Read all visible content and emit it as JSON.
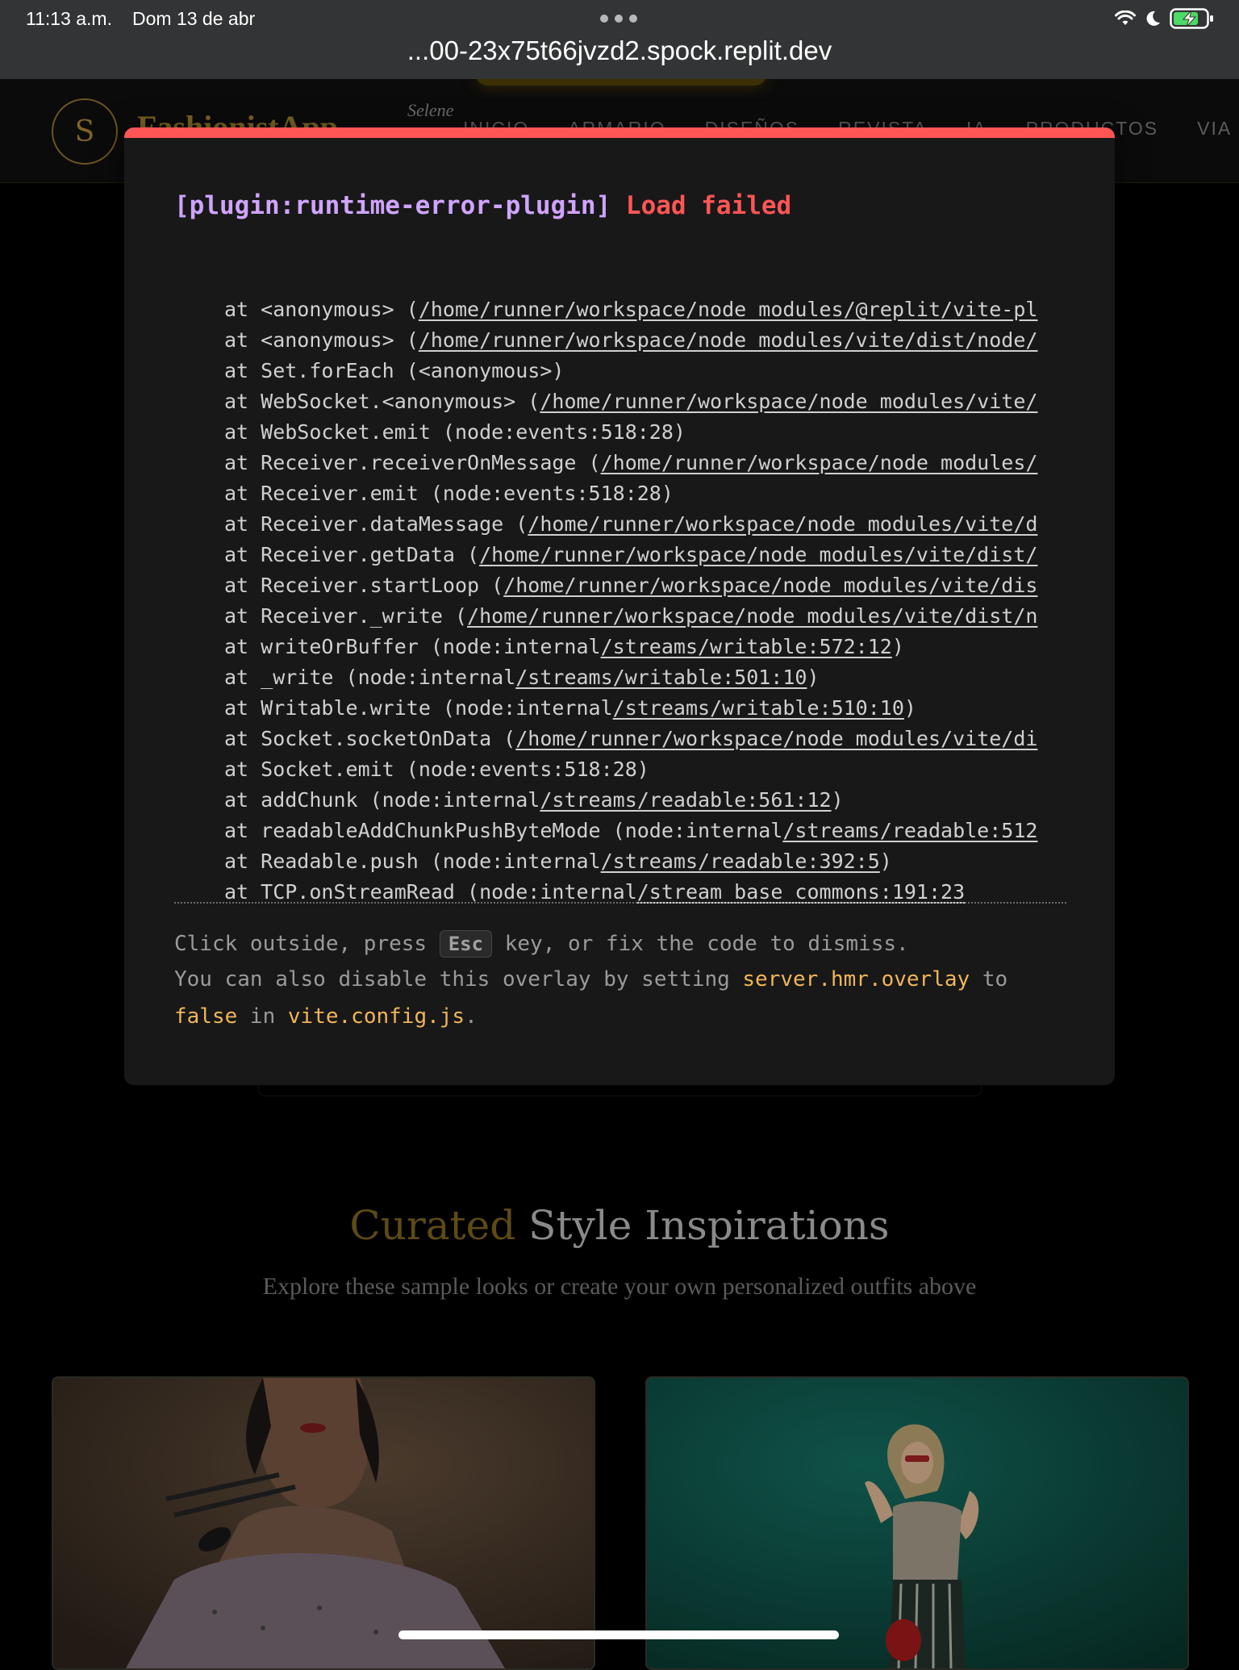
{
  "status_bar": {
    "time": "11:13 a.m.",
    "date": "Dom 13 de abr",
    "url": "...00-23x75t66jvzd2.spock.replit.dev",
    "battery_color": "#4cd964"
  },
  "site": {
    "logo_letter": "S",
    "logo_text": "FashionistApp",
    "logo_sub": "Selene",
    "nav": [
      "INICIO",
      "ARMARIO",
      "DISEÑOS",
      "REVISTA",
      "IA",
      "PRODUCTOS",
      "VIA"
    ],
    "section_title_accent": "Curated",
    "section_title_rest": "Style Inspirations",
    "section_subtitle": "Explore these sample looks or create your own personalized outfits above"
  },
  "overlay": {
    "plugin": "[plugin:runtime-error-plugin]",
    "message": "Load failed",
    "accent_color": "#ff5555",
    "stack": [
      {
        "prefix": "at <anonymous> (",
        "link": "/home/runner/workspace/node_modules/@replit/vite-pl",
        "suffix": ""
      },
      {
        "prefix": "at <anonymous> (",
        "link": "/home/runner/workspace/node_modules/vite/dist/node/",
        "suffix": ""
      },
      {
        "prefix": "at Set.forEach (<anonymous>)",
        "link": "",
        "suffix": ""
      },
      {
        "prefix": "at WebSocket.<anonymous> (",
        "link": "/home/runner/workspace/node_modules/vite/",
        "suffix": ""
      },
      {
        "prefix": "at WebSocket.emit (node:events:518:28)",
        "link": "",
        "suffix": ""
      },
      {
        "prefix": "at Receiver.receiverOnMessage (",
        "link": "/home/runner/workspace/node_modules/",
        "suffix": ""
      },
      {
        "prefix": "at Receiver.emit (node:events:518:28)",
        "link": "",
        "suffix": ""
      },
      {
        "prefix": "at Receiver.dataMessage (",
        "link": "/home/runner/workspace/node_modules/vite/d",
        "suffix": ""
      },
      {
        "prefix": "at Receiver.getData (",
        "link": "/home/runner/workspace/node_modules/vite/dist/",
        "suffix": ""
      },
      {
        "prefix": "at Receiver.startLoop (",
        "link": "/home/runner/workspace/node_modules/vite/dis",
        "suffix": ""
      },
      {
        "prefix": "at Receiver._write (",
        "link": "/home/runner/workspace/node_modules/vite/dist/n",
        "suffix": ""
      },
      {
        "prefix": "at writeOrBuffer (node:internal",
        "link": "/streams/writable:572:12",
        "suffix": ")"
      },
      {
        "prefix": "at _write (node:internal",
        "link": "/streams/writable:501:10",
        "suffix": ")"
      },
      {
        "prefix": "at Writable.write (node:internal",
        "link": "/streams/writable:510:10",
        "suffix": ")"
      },
      {
        "prefix": "at Socket.socketOnData (",
        "link": "/home/runner/workspace/node_modules/vite/di",
        "suffix": ""
      },
      {
        "prefix": "at Socket.emit (node:events:518:28)",
        "link": "",
        "suffix": ""
      },
      {
        "prefix": "at addChunk (node:internal",
        "link": "/streams/readable:561:12",
        "suffix": ")"
      },
      {
        "prefix": "at readableAddChunkPushByteMode (node:internal",
        "link": "/streams/readable:512",
        "suffix": ""
      },
      {
        "prefix": "at Readable.push (node:internal",
        "link": "/streams/readable:392:5",
        "suffix": ")"
      },
      {
        "prefix": "at TCP.onStreamRead (node:internal",
        "link": "/stream_base_commons:191:23",
        "suffix": ""
      }
    ],
    "tip1_before": "Click outside, press ",
    "tip1_key": "Esc",
    "tip1_after": " key, or fix the code to dismiss.",
    "tip2_before": "You can also disable this overlay by setting ",
    "tip2_code": "server.hmr.overlay",
    "tip2_after": " to",
    "tip3_code1": "false",
    "tip3_mid": " in ",
    "tip3_code2": "vite.config.js",
    "tip3_end": "."
  }
}
